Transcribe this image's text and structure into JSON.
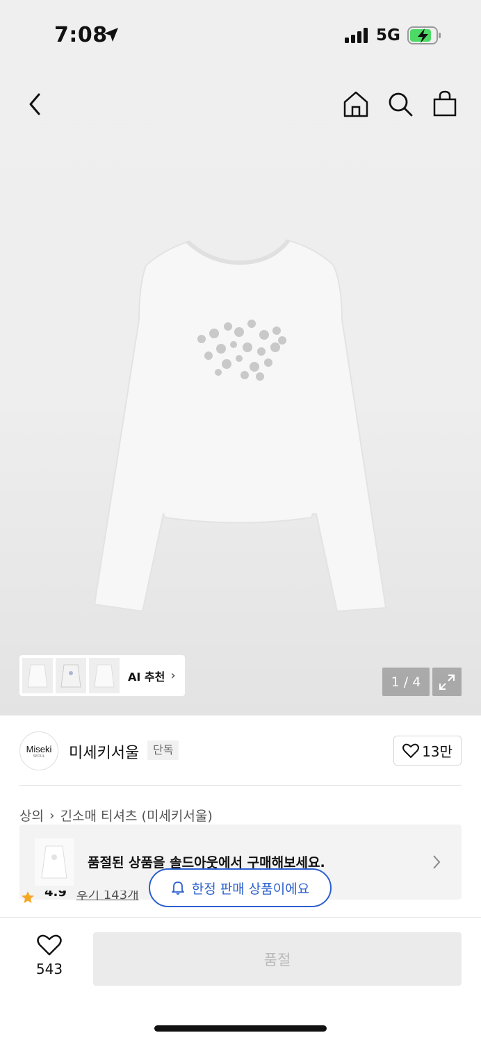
{
  "status_bar": {
    "time": "7:08",
    "network": "5G"
  },
  "gallery": {
    "ai_label": "AI 추천",
    "pager": "1 / 4"
  },
  "brand": {
    "logo_text": "Miseki",
    "logo_sub": "SEOUL",
    "name": "미세키서울",
    "badge": "단독",
    "likes": "13만"
  },
  "breadcrumb": {
    "category": "상의",
    "subcategory": "긴소매 티셔츠 (미세키서울)"
  },
  "soldout_banner": {
    "text": "품절된 상품을 솔드아웃에서 구매해보세요."
  },
  "rating": {
    "score": "4.9",
    "review_link": "후기 143개"
  },
  "limited_badge": {
    "text": "한정 판매 상품이에요"
  },
  "bottom": {
    "wish_count": "543",
    "buy_label": "품절"
  },
  "colors": {
    "accent": "#2b5fcf",
    "battery": "#4cd964",
    "disabled_text": "#b9b9b9"
  }
}
